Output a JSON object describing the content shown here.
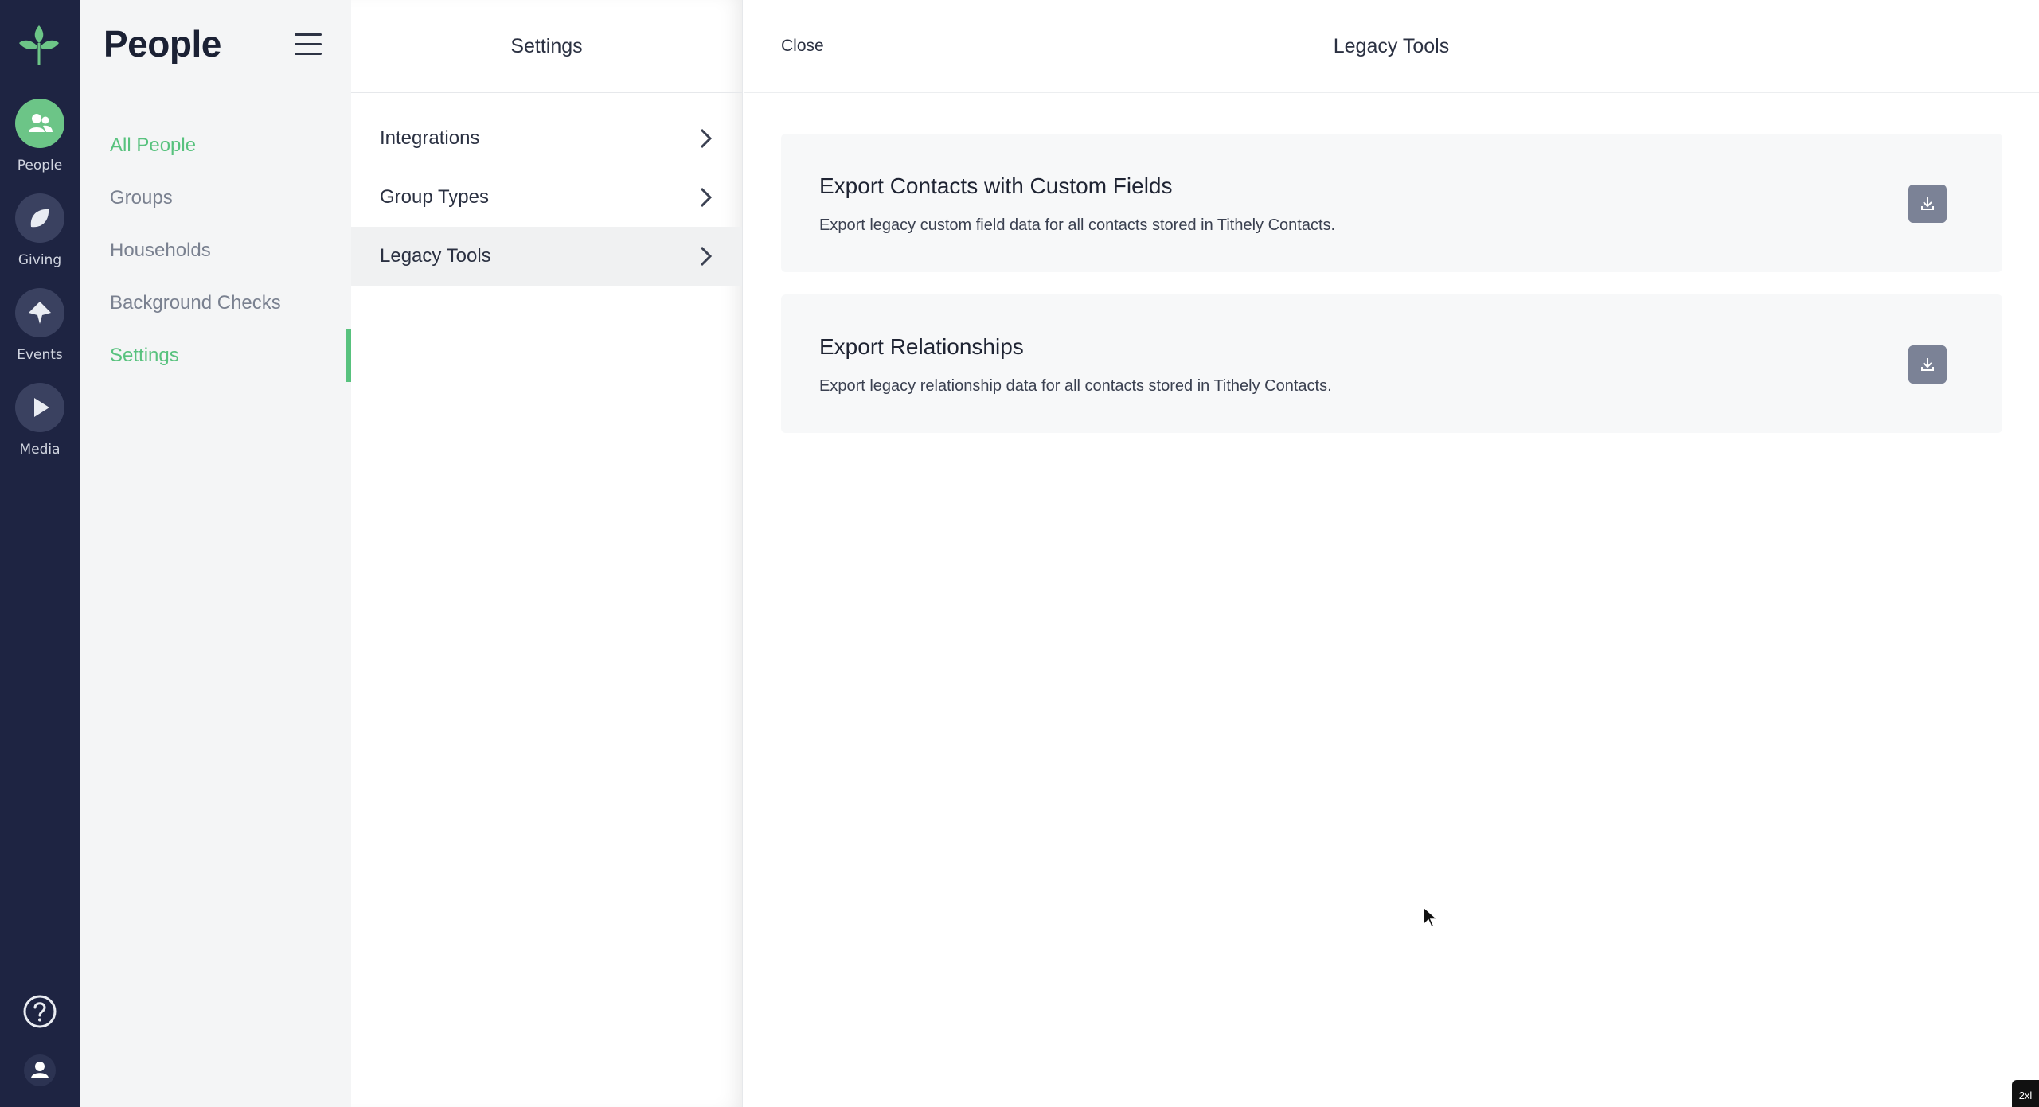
{
  "rail": {
    "items": [
      {
        "label": "People",
        "icon": "people-icon"
      },
      {
        "label": "Giving",
        "icon": "leaf-icon"
      },
      {
        "label": "Events",
        "icon": "pin-icon"
      },
      {
        "label": "Media",
        "icon": "play-icon"
      }
    ],
    "bottom": [
      {
        "icon": "help-icon"
      },
      {
        "icon": "user-icon"
      }
    ]
  },
  "section": {
    "title": "People",
    "nav": [
      {
        "label": "All People"
      },
      {
        "label": "Groups"
      },
      {
        "label": "Households"
      },
      {
        "label": "Background Checks"
      },
      {
        "label": "Settings"
      }
    ]
  },
  "settings": {
    "title": "Settings",
    "rows": [
      {
        "label": "Integrations"
      },
      {
        "label": "Group Types"
      },
      {
        "label": "Legacy Tools"
      }
    ]
  },
  "content": {
    "close_label": "Close",
    "title": "Legacy Tools",
    "cards": [
      {
        "title": "Export Contacts with Custom Fields",
        "description": "Export legacy custom field data for all contacts stored in Tithely Contacts."
      },
      {
        "title": "Export Relationships",
        "description": "Export legacy relationship data for all contacts stored in Tithely Contacts."
      }
    ]
  },
  "badge": "2xl",
  "colors": {
    "rail_bg": "#1e2442",
    "accent_green": "#58c27e",
    "download_btn": "#7b8296"
  }
}
